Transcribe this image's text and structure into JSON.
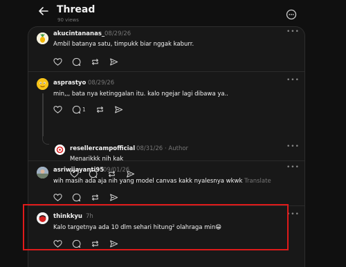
{
  "header": {
    "title": "Thread",
    "views": "90 views"
  },
  "posts": [
    {
      "username": "akucintananas_",
      "date": "08/29/26",
      "text": "Ambil batanya satu, timpukk biar nggak kaburr."
    },
    {
      "username": "asprastyo",
      "date": "08/29/26",
      "text": "min,,, bata nya ketinggalan itu. kalo ngejar lagi dibawa ya..",
      "reply_count": "1"
    },
    {
      "username": "resellercampofficial",
      "date": "08/31/26",
      "tag": "· Author",
      "text": "Menarikkk nih kak"
    },
    {
      "username": "asriwijayanti95",
      "date": "09/01/26",
      "text": "wih masih ada aja nih yang model canvas kakk nyalesnya wkwk",
      "translate": "Translate"
    },
    {
      "username": "thinkkyu",
      "date": "7h",
      "text": "Kalo targetnya ada 10 dlm sehari hitung² olahraga min😁"
    }
  ],
  "colors": {
    "highlight": "#e01a1a",
    "background": "#101010",
    "panel": "#181818"
  }
}
